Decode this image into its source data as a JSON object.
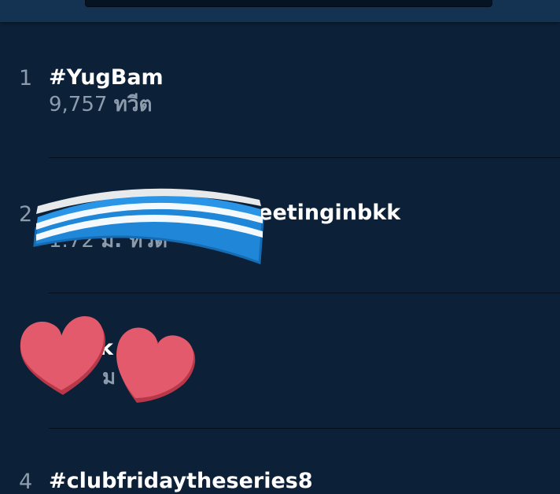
{
  "trends": [
    {
      "rank": "1",
      "hashtag": "#YugBam",
      "count": "9,757",
      "unit": "ทวีต"
    },
    {
      "rank": "2",
      "hashtag": "meetinginbkk",
      "count": "1.72",
      "unit": "ม. ทวีต"
    },
    {
      "rank": "",
      "hashtag": "k",
      "count": "",
      "unit": "ม"
    },
    {
      "rank": "4",
      "hashtag": "#clubfridaytheseries8",
      "count": "",
      "unit": ""
    }
  ],
  "stickers": {
    "band": {
      "icon": "striped-headband-sticker",
      "colors": [
        "#2a95e6",
        "#ffffff"
      ]
    },
    "hearts": {
      "icon": "heart-sticker",
      "color": "#e35a6c"
    }
  },
  "colors": {
    "background": "#0c2038",
    "topbar": "#143352",
    "text": "#ffffff",
    "muted": "#8c9cac",
    "divider": "#050f1c"
  }
}
